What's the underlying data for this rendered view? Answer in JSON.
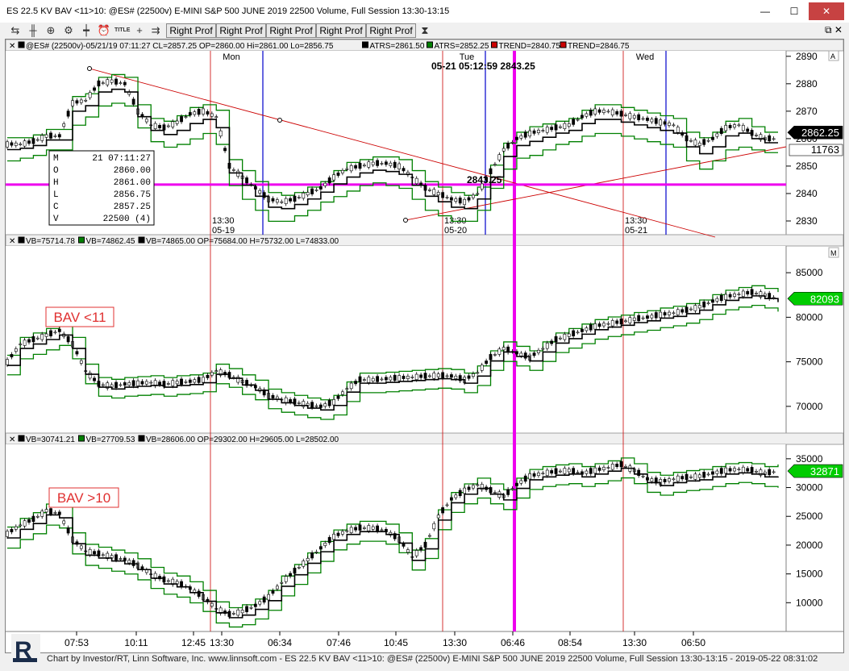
{
  "window": {
    "title": "ES 22.5 KV BAV <11>10: @ES# (22500v) E-MINI S&P 500 JUNE 2019 22500 Volume, Full Session 13:30-13:15",
    "minimize": "—",
    "maximize": "☐",
    "close": "✕"
  },
  "toolbar": {
    "icons": [
      "sync-icon",
      "bar-style-icon",
      "zoom-icon",
      "gear-icon",
      "candle-icon",
      "clock-icon",
      "title-icon",
      "crosshair-icon",
      "draw-icon"
    ],
    "title_icon_text": "TITLE",
    "buttons": [
      "Right Prof",
      "Right Prof",
      "Right Prof",
      "Right Prof",
      "Right Prof"
    ],
    "hourglass": "⧗",
    "mdi": "⧉ ✕"
  },
  "panel1": {
    "header_segments": [
      {
        "text": "@ES# (22500v)-05/21/19 07:11:27 CL=2857.25 OP=2860.00 Hi=2861.00 Lo=2856.75",
        "color": "#000000"
      },
      {
        "text": "ATRS=2861.50",
        "color": "#000000"
      },
      {
        "text": "ATRS=2852.25",
        "color": "#008000"
      },
      {
        "text": "TREND=2840.75",
        "color": "#cc0000"
      },
      {
        "text": "TREND=2846.75",
        "color": "#cc0000"
      }
    ],
    "corner_label": "A",
    "day_labels": [
      "Mon",
      "Tue",
      "Wed"
    ],
    "cursor_text": "05-21 05:12:59  2843.25",
    "hline_label": "2843.25",
    "session_labels": [
      [
        "13:30",
        "05-19"
      ],
      [
        "13:30",
        "05-20"
      ],
      [
        "13:30",
        "05-21"
      ]
    ],
    "last_price": "2862.25",
    "last_volume": "11763",
    "yticks": [
      "2890",
      "2880",
      "2870",
      "2860",
      "2850",
      "2840",
      "2830"
    ],
    "ohlc_box": {
      "rows": [
        [
          "M",
          "21 07:11:27"
        ],
        [
          "O",
          "2860.00"
        ],
        [
          "H",
          "2861.00"
        ],
        [
          "L",
          "2856.75"
        ],
        [
          "C",
          "2857.25"
        ],
        [
          "V",
          "22500 (4)"
        ]
      ]
    }
  },
  "panel2": {
    "header_segments": [
      {
        "text": "VB=75714.78",
        "color": "#000000"
      },
      {
        "text": "VB=74862.45",
        "color": "#008000"
      },
      {
        "text": "VB=74865.00 OP=75684.00 H=75732.00 L=74833.00",
        "color": "#000000"
      }
    ],
    "corner_label": "M",
    "annotation": "BAV <11",
    "last_value": "82093",
    "yticks": [
      "85000",
      "80000",
      "75000",
      "70000"
    ]
  },
  "panel3": {
    "header_segments": [
      {
        "text": "VB=30741.21",
        "color": "#000000"
      },
      {
        "text": "VB=27709.53",
        "color": "#008000"
      },
      {
        "text": "VB=28606.00 OP=29302.00 H=29605.00 L=28502.00",
        "color": "#000000"
      }
    ],
    "annotation": "BAV >10",
    "last_value": "32871",
    "yticks": [
      "35000",
      "30000",
      "25000",
      "20000",
      "15000",
      "10000"
    ]
  },
  "xaxis": {
    "labels": [
      "07:53",
      "10:11",
      "12:45",
      "13:30",
      "06:34",
      "07:46",
      "10:45",
      "13:30",
      "06:46",
      "08:54",
      "13:30",
      "06:50"
    ]
  },
  "footer": "Chart by Investor/RT, Linn Software, Inc. www.linnsoft.com - ES 22.5 KV BAV <11>10: @ES# (22500v) E-MINI S&P 500 JUNE 2019 22500 Volume, Full Session 13:30-13:15 - 2019-05-22 08:31:02",
  "colors": {
    "price_up": "#000000",
    "band_green": "#008000",
    "trend_red": "#cc0000",
    "cursor_magenta": "#ee00ee",
    "session_blue": "#0000cc",
    "label_green": "#00cc00"
  },
  "chart_data": [
    {
      "type": "line",
      "title": "@ES# (22500v) price with ATRS bands and trend lines",
      "ylim": [
        2825,
        2892
      ],
      "x_sessions": [
        "05-19 13:30",
        "05-20 13:30",
        "05-21 13:30"
      ],
      "series": [
        {
          "name": "ATRS",
          "values": [
            2858,
            2858,
            2859,
            2861,
            2861,
            2873,
            2874,
            2880,
            2881,
            2880,
            2870,
            2865,
            2864,
            2866,
            2869,
            2870,
            2868,
            2850,
            2846,
            2842,
            2838,
            2837,
            2838,
            2840,
            2842,
            2846,
            2849,
            2850,
            2851,
            2851,
            2850,
            2846,
            2842,
            2840,
            2838,
            2837,
            2840,
            2848,
            2856,
            2860,
            2862,
            2863,
            2864,
            2865,
            2868,
            2870,
            2870,
            2869,
            2868,
            2867,
            2866,
            2865,
            2860,
            2858,
            2860,
            2864,
            2865,
            2862,
            2860,
            2860
          ]
        },
        {
          "name": "ATRS",
          "values": [
            2854,
            2855,
            2856,
            2858,
            2858,
            2867,
            2870,
            2874,
            2875,
            2874,
            2866,
            2861,
            2859,
            2860,
            2862,
            2864,
            2860,
            2845,
            2840,
            2836,
            2832,
            2832,
            2834,
            2836,
            2839,
            2841,
            2843,
            2845,
            2846,
            2845,
            2844,
            2840,
            2836,
            2834,
            2832,
            2832,
            2836,
            2844,
            2851,
            2855,
            2856,
            2858,
            2860,
            2861,
            2863,
            2864,
            2864,
            2863,
            2862,
            2861,
            2860,
            2859,
            2854,
            2851,
            2854,
            2858,
            2859,
            2858,
            2857,
            2857
          ]
        }
      ],
      "trend_lines": [
        {
          "name": "TREND",
          "from": 2885,
          "to": 2826
        },
        {
          "name": "TREND",
          "from": 2832,
          "to": 2857
        }
      ],
      "hline": 2843.25
    },
    {
      "type": "line",
      "title": "BAV <11",
      "ylim": [
        67000,
        88000
      ],
      "series": [
        {
          "name": "VB",
          "values": [
            75000,
            77000,
            77500,
            78000,
            78500,
            77000,
            74000,
            72500,
            72300,
            72500,
            72600,
            72700,
            72500,
            72700,
            72800,
            73000,
            74000,
            73500,
            72800,
            72200,
            71200,
            70800,
            70500,
            70200,
            70000,
            70500,
            72000,
            73000,
            73000,
            73100,
            73200,
            73300,
            73400,
            73500,
            73400,
            73000,
            73800,
            75500,
            76500,
            76000,
            75500,
            76500,
            77500,
            78000,
            78500,
            79000,
            79300,
            79500,
            79800,
            80000,
            80300,
            80500,
            80800,
            81200,
            81800,
            82300,
            82600,
            82800,
            82500,
            82093
          ]
        },
        {
          "name": "VB",
          "values": [
            74200,
            76000,
            76500,
            77000,
            77500,
            76000,
            73200,
            71800,
            71600,
            71800,
            71900,
            72000,
            71800,
            72000,
            72100,
            72300,
            73200,
            72800,
            72000,
            71400,
            70400,
            70000,
            69700,
            69400,
            69200,
            69700,
            71200,
            72200,
            72200,
            72300,
            72400,
            72500,
            72600,
            72700,
            72600,
            72200,
            73000,
            74700,
            75700,
            75200,
            74700,
            75700,
            76700,
            77200,
            77700,
            78200,
            78500,
            78700,
            79000,
            79200,
            79500,
            79700,
            80000,
            80400,
            81000,
            81500,
            81800,
            82000,
            81700,
            81300
          ]
        }
      ]
    },
    {
      "type": "line",
      "title": "BAV >10",
      "ylim": [
        5000,
        37500
      ],
      "series": [
        {
          "name": "VB",
          "values": [
            22000,
            23500,
            24500,
            26000,
            25500,
            21000,
            19000,
            18500,
            18000,
            17500,
            16500,
            15000,
            14000,
            13500,
            12500,
            11000,
            9000,
            8000,
            8500,
            9500,
            11000,
            13500,
            15500,
            17500,
            19500,
            21500,
            22500,
            23000,
            23000,
            22500,
            21000,
            18000,
            20000,
            25000,
            28000,
            29500,
            30500,
            29500,
            28500,
            30500,
            32000,
            32500,
            32800,
            33000,
            32500,
            33000,
            33500,
            34000,
            33000,
            31500,
            31000,
            31500,
            31800,
            32000,
            32500,
            33000,
            33200,
            33000,
            32500,
            32871
          ]
        },
        {
          "name": "VB",
          "values": [
            20500,
            22000,
            23000,
            24500,
            24000,
            19500,
            17500,
            17000,
            16500,
            16000,
            15000,
            13500,
            12500,
            12000,
            11000,
            9500,
            7500,
            6800,
            7200,
            8200,
            9700,
            12200,
            14200,
            16200,
            18200,
            20200,
            21200,
            21700,
            21700,
            21200,
            19700,
            16700,
            18700,
            23700,
            26700,
            28200,
            29200,
            28200,
            27200,
            29200,
            30700,
            31200,
            31500,
            31700,
            31200,
            31700,
            32200,
            32700,
            31700,
            30200,
            29700,
            30200,
            30500,
            30700,
            31200,
            31700,
            31900,
            31700,
            31200,
            31000
          ]
        }
      ]
    }
  ]
}
